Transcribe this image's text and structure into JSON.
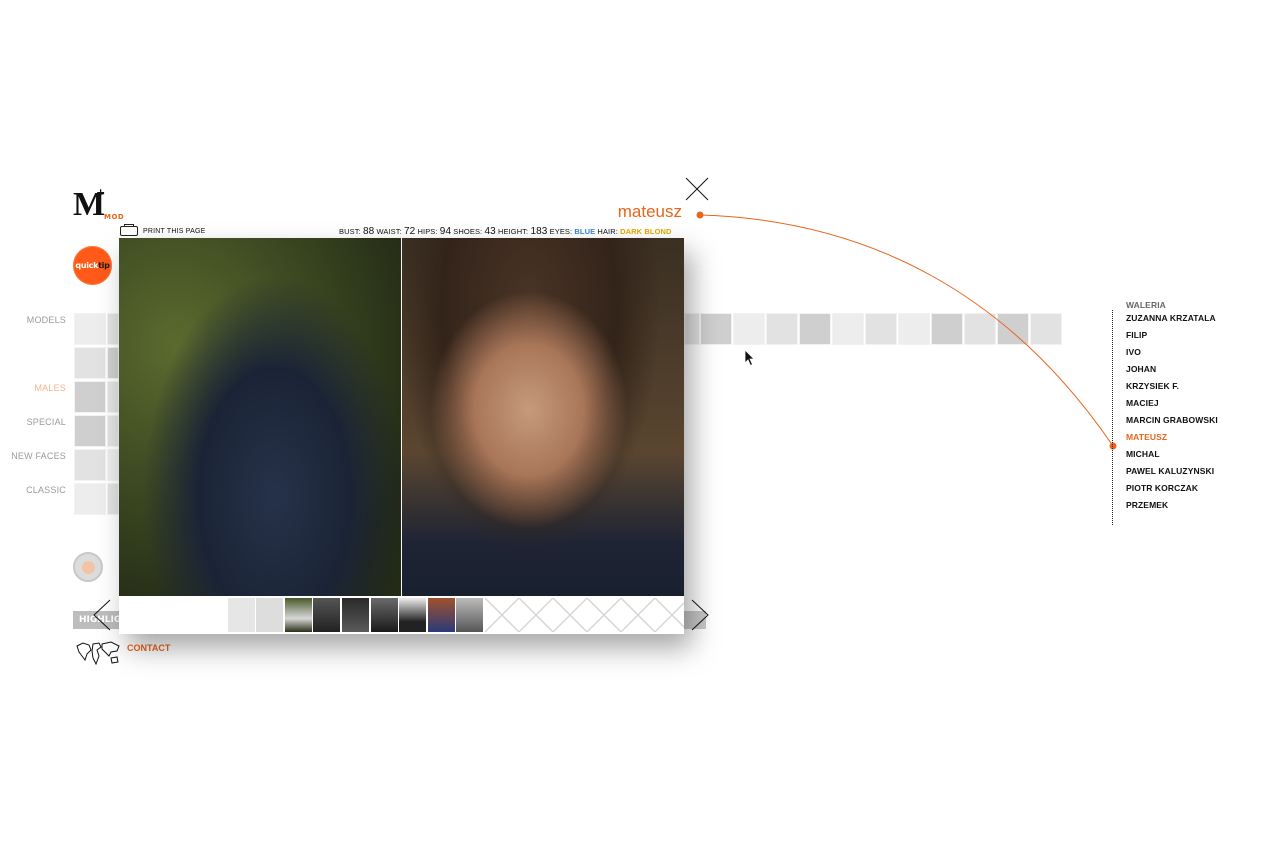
{
  "logo": {
    "mark": "M",
    "plus": "+",
    "text": "MOD"
  },
  "quicktip": {
    "part1": "quick",
    "part2": "tip"
  },
  "nav": {
    "models": "MODELS",
    "males": "MALES",
    "special": "SPECIAL",
    "new_faces": "NEW FACES",
    "classic": "CLASSIC"
  },
  "highlights": "HIGHLIG",
  "contact": "CONTACT",
  "modal": {
    "print_label": "PRINT THIS PAGE",
    "model_name": "mateusz",
    "stats": {
      "bust_label": "BUST:",
      "bust": "88",
      "waist_label": "WAIST:",
      "waist": "72",
      "hips_label": "HIPS:",
      "hips": "94",
      "shoes_label": "SHOES:",
      "shoes": "43",
      "height_label": "HEIGHT:",
      "height": "183",
      "eyes_label": "EYES:",
      "eyes": "BLUE",
      "hair_label": "HAIR:",
      "hair": "DARK BLOND"
    }
  },
  "model_list": [
    {
      "name": "WALERIA",
      "state": "cut"
    },
    {
      "name": "ZUZANNA KRZATALA",
      "state": "normal"
    },
    {
      "name": "FILIP",
      "state": "normal"
    },
    {
      "name": "IVO",
      "state": "normal"
    },
    {
      "name": "JOHAN",
      "state": "normal"
    },
    {
      "name": "KRZYSIEK F.",
      "state": "normal"
    },
    {
      "name": "MACIEJ",
      "state": "normal"
    },
    {
      "name": "MARCIN GRABOWSKI",
      "state": "normal"
    },
    {
      "name": "MATEUSZ",
      "state": "active"
    },
    {
      "name": "MICHAL",
      "state": "normal"
    },
    {
      "name": "PAWEL KALUZYNSKI",
      "state": "normal"
    },
    {
      "name": "PIOTR KORCZAK",
      "state": "normal"
    },
    {
      "name": "PRZEMEK",
      "state": "normal"
    }
  ],
  "colors": {
    "accent": "#e8651a",
    "eyes": "#3a8ad0",
    "hair": "#e6a800"
  },
  "icons": [
    "print-icon",
    "close-icon",
    "prev-arrow-icon",
    "next-arrow-icon",
    "world-map-icon"
  ]
}
